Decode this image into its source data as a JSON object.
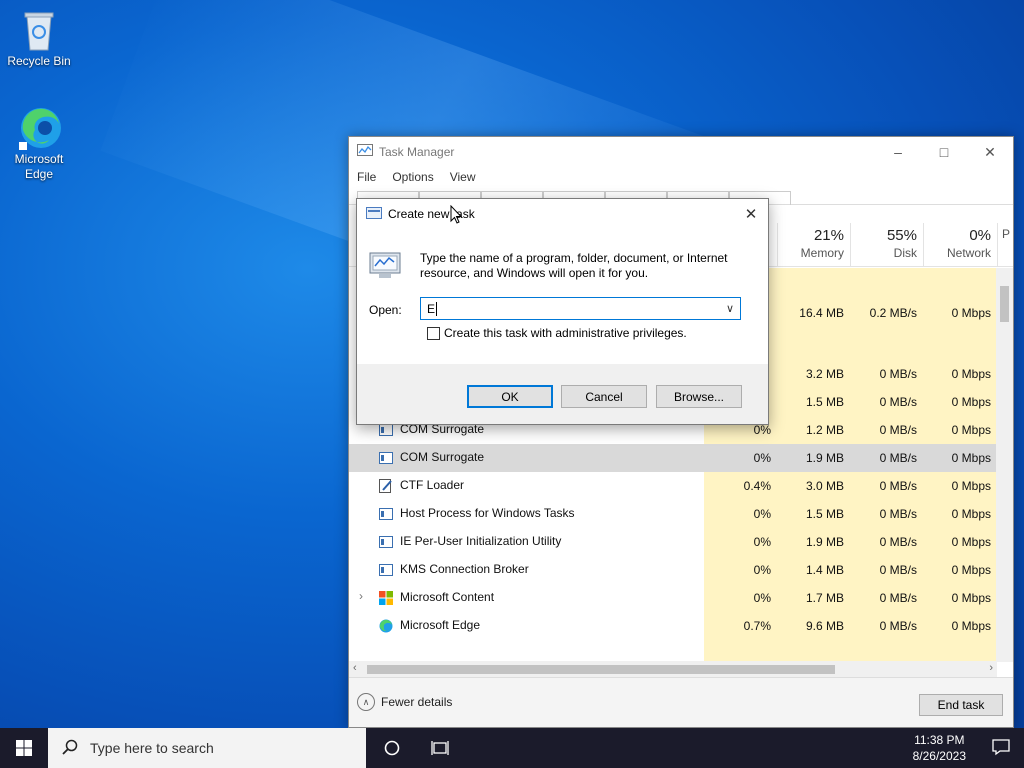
{
  "desktop": {
    "icons": [
      {
        "label": "Recycle Bin"
      },
      {
        "label": "Microsoft Edge"
      }
    ]
  },
  "taskmanager": {
    "title": "Task Manager",
    "menu": [
      "File",
      "Options",
      "View"
    ],
    "columns": [
      {
        "pct": "21%",
        "label": "Memory"
      },
      {
        "pct": "55%",
        "label": "Disk"
      },
      {
        "pct": "0%",
        "label": "Network"
      },
      {
        "pct": "",
        "label": "P"
      }
    ],
    "rows": [
      {
        "name": "",
        "cpu": "",
        "mem": "",
        "disk": "",
        "net": ""
      },
      {
        "name": "",
        "cpu": "",
        "mem": "16.4 MB",
        "disk": "0.2 MB/s",
        "net": "0 Mbps"
      },
      {
        "name": "",
        "cpu": "",
        "mem": "",
        "disk": "",
        "net": ""
      },
      {
        "name": "",
        "cpu": "",
        "mem": "3.2 MB",
        "disk": "0 MB/s",
        "net": "0 Mbps"
      },
      {
        "name": "",
        "cpu": "",
        "mem": "1.5 MB",
        "disk": "0 MB/s",
        "net": "0 Mbps"
      },
      {
        "name": "COM Surrogate",
        "cpu": "0%",
        "mem": "1.2 MB",
        "disk": "0 MB/s",
        "net": "0 Mbps"
      },
      {
        "name": "COM Surrogate",
        "cpu": "0%",
        "mem": "1.9 MB",
        "disk": "0 MB/s",
        "net": "0 Mbps"
      },
      {
        "name": "CTF Loader",
        "cpu": "0.4%",
        "mem": "3.0 MB",
        "disk": "0 MB/s",
        "net": "0 Mbps"
      },
      {
        "name": "Host Process for Windows Tasks",
        "cpu": "0%",
        "mem": "1.5 MB",
        "disk": "0 MB/s",
        "net": "0 Mbps"
      },
      {
        "name": "IE Per-User Initialization Utility",
        "cpu": "0%",
        "mem": "1.9 MB",
        "disk": "0 MB/s",
        "net": "0 Mbps"
      },
      {
        "name": "KMS Connection Broker",
        "cpu": "0%",
        "mem": "1.4 MB",
        "disk": "0 MB/s",
        "net": "0 Mbps"
      },
      {
        "name": "Microsoft Content",
        "cpu": "0%",
        "mem": "1.7 MB",
        "disk": "0 MB/s",
        "net": "0 Mbps"
      },
      {
        "name": "Microsoft Edge",
        "cpu": "0.7%",
        "mem": "9.6 MB",
        "disk": "0 MB/s",
        "net": "0 Mbps"
      }
    ],
    "footer": {
      "fewer": "Fewer details",
      "endtask": "End task"
    }
  },
  "run": {
    "title": "Create new task",
    "description": "Type the name of a program, folder, document, or Internet resource, and Windows will open it for you.",
    "open_label": "Open:",
    "input_value": "E",
    "checkbox_label": "Create this task with administrative privileges.",
    "ok": "OK",
    "cancel": "Cancel",
    "browse": "Browse..."
  },
  "taskbar": {
    "search_placeholder": "Type here to search",
    "time": "11:38 PM",
    "date": "8/26/2023"
  },
  "colors": {
    "accent": "#0078d7",
    "highlight": "#fff4c4",
    "taskbar": "#1b1b2b"
  }
}
